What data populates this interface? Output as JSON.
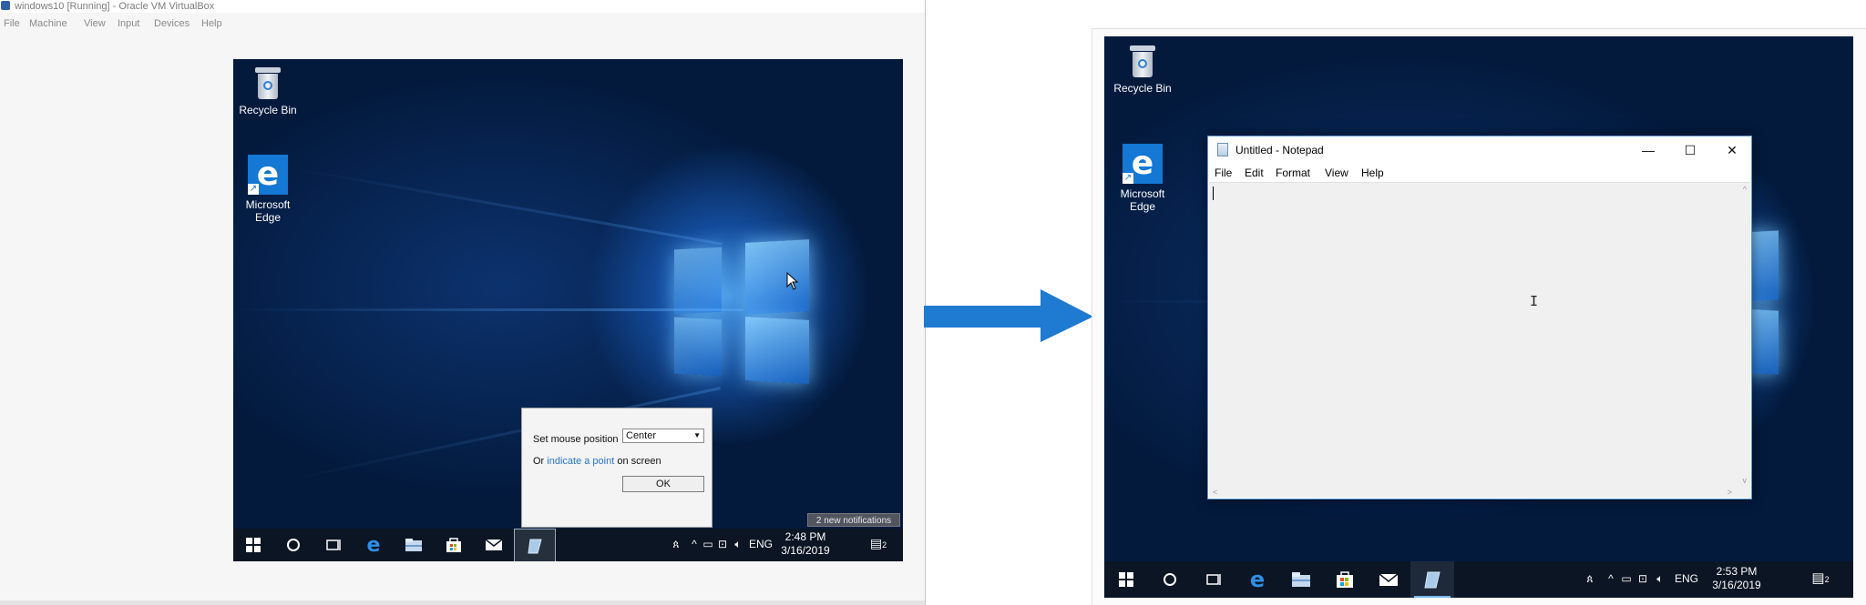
{
  "vbox": {
    "title": "windows10 [Running] - Oracle VM VirtualBox",
    "menu": [
      "File",
      "Machine",
      "View",
      "Input",
      "Devices",
      "Help"
    ]
  },
  "left_desktop": {
    "icons": [
      {
        "label": "Recycle Bin",
        "icon": "recycle-bin-icon"
      },
      {
        "label": "Microsoft Edge",
        "icon": "edge-icon"
      }
    ],
    "dialog": {
      "label": "Set mouse position",
      "selected": "Center",
      "line2_prefix": "Or ",
      "line2_link": "indicate a point",
      "line2_suffix": " on screen",
      "ok": "OK"
    },
    "notification_badge": "2 new notifications",
    "tray": {
      "lang": "ENG",
      "time": "2:48 PM",
      "date": "3/16/2019",
      "notif_count": "2"
    }
  },
  "right_desktop": {
    "icons": [
      {
        "label": "Recycle Bin",
        "icon": "recycle-bin-icon"
      },
      {
        "label": "Microsoft Edge",
        "icon": "edge-icon"
      }
    ],
    "notepad": {
      "title": "Untitled - Notepad",
      "menu": [
        "File",
        "Edit",
        "Format",
        "View",
        "Help"
      ],
      "minimize": "—",
      "maximize": "☐",
      "close": "✕"
    },
    "tray": {
      "lang": "ENG",
      "time": "2:53 PM",
      "date": "3/16/2019",
      "notif_count": "2"
    }
  },
  "colors": {
    "accent": "#1f7ad1",
    "taskbar": "#0b1523",
    "arrow": "#1f7ad1"
  }
}
